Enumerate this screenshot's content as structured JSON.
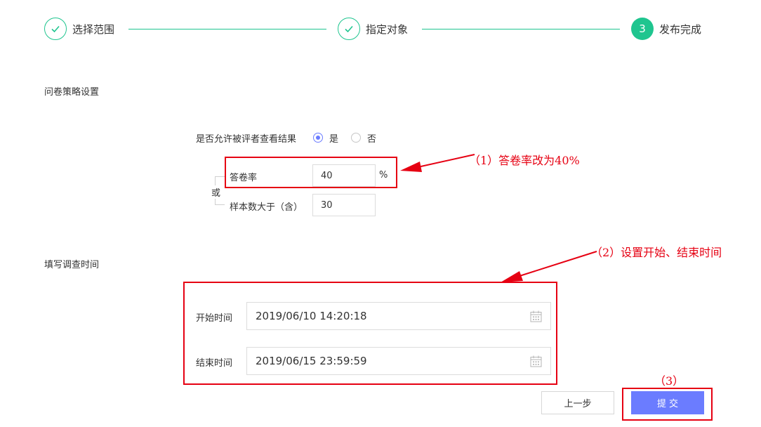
{
  "steps": [
    {
      "label": "选择范围",
      "state": "done"
    },
    {
      "label": "指定对象",
      "state": "done"
    },
    {
      "number": "3",
      "label": "发布完成",
      "state": "active"
    }
  ],
  "strategy": {
    "section_title": "问卷策略设置",
    "allow_view_label": "是否允许被评者查看结果",
    "option_yes": "是",
    "option_no": "否",
    "selected": "是",
    "or_label": "或",
    "response_rate_label": "答卷率",
    "response_rate_value": "40",
    "response_rate_unit": "%",
    "sample_label": "样本数大于（含）",
    "sample_value": "30"
  },
  "schedule": {
    "section_title": "填写调查时间",
    "start_label": "开始时间",
    "start_value": "2019/06/10 14:20:18",
    "end_label": "结束时间",
    "end_value": "2019/06/15 23:59:59"
  },
  "buttons": {
    "prev": "上一步",
    "submit": "提 交"
  },
  "annotations": {
    "note1": "（1）答卷率改为40%",
    "note2": "（2）设置开始、结束时间",
    "note3": "（3）"
  },
  "colors": {
    "step_green": "#1fc58f",
    "primary": "#6b7cff",
    "annotation_red": "#e60012"
  }
}
